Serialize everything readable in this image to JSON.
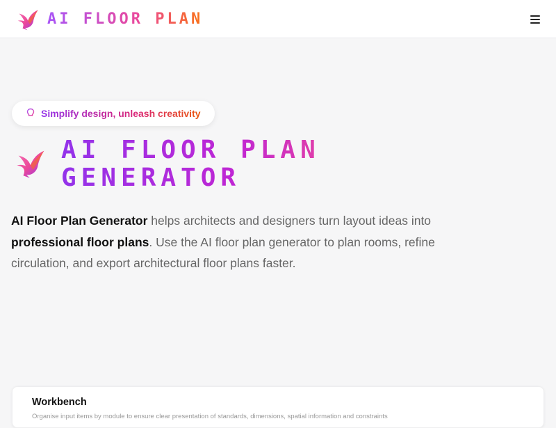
{
  "header": {
    "brand_name": "AI FLOOR PLAN",
    "logo_icon": "bird-logo-icon",
    "menu_icon": "hamburger-menu-icon"
  },
  "hero": {
    "badge_icon": "lightbulb-icon",
    "badge_text": "Simplify design, unleash creativity",
    "title_line1": "AI FLOOR PLAN",
    "title_line2": "GENERATOR",
    "description": {
      "strong1": "AI Floor Plan Generator",
      "text1": " helps architects and designers turn layout ideas into ",
      "strong2": "professional floor plans",
      "text2": ". Use the AI floor plan generator to plan rooms, refine circulation, and export architectural floor plans faster."
    }
  },
  "workbench": {
    "title": "Workbench",
    "subtitle": "Organise input items by module to ensure clear presentation of standards, dimensions, spatial information and constraints"
  },
  "colors": {
    "gradient_start": "#9333ea",
    "gradient_mid": "#ec4899",
    "gradient_end": "#f97316",
    "background": "#f6f6f7"
  }
}
